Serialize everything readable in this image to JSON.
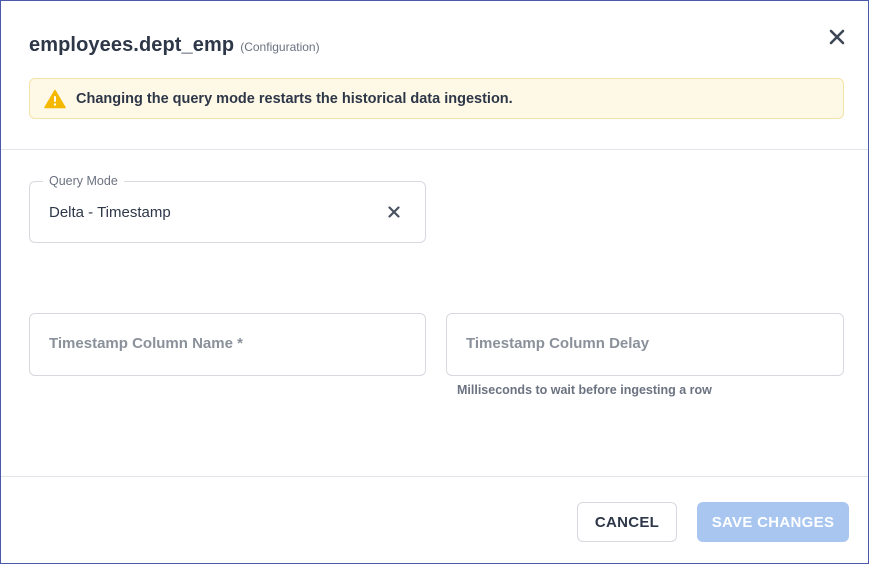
{
  "dialog": {
    "title": "employees.dept_emp",
    "subtitle": "(Configuration)",
    "close_icon": "close-icon"
  },
  "warning": {
    "icon": "warning-triangle-icon",
    "icon_color": "#f5b800",
    "text": "Changing the query mode restarts the historical data ingestion."
  },
  "form": {
    "query_mode": {
      "label": "Query Mode",
      "value": "Delta - Timestamp",
      "clear_icon": "clear-icon"
    },
    "timestamp_column_name": {
      "placeholder": "Timestamp Column Name *"
    },
    "timestamp_column_delay": {
      "placeholder": "Timestamp Column Delay",
      "helper": "Milliseconds to wait before ingesting a row"
    }
  },
  "footer": {
    "cancel_label": "CANCEL",
    "save_label": "SAVE CHANGES"
  },
  "colors": {
    "border_accent": "#4a5aa8",
    "warning_bg": "#fef8e6",
    "save_button_disabled": "#a8c6f0"
  }
}
